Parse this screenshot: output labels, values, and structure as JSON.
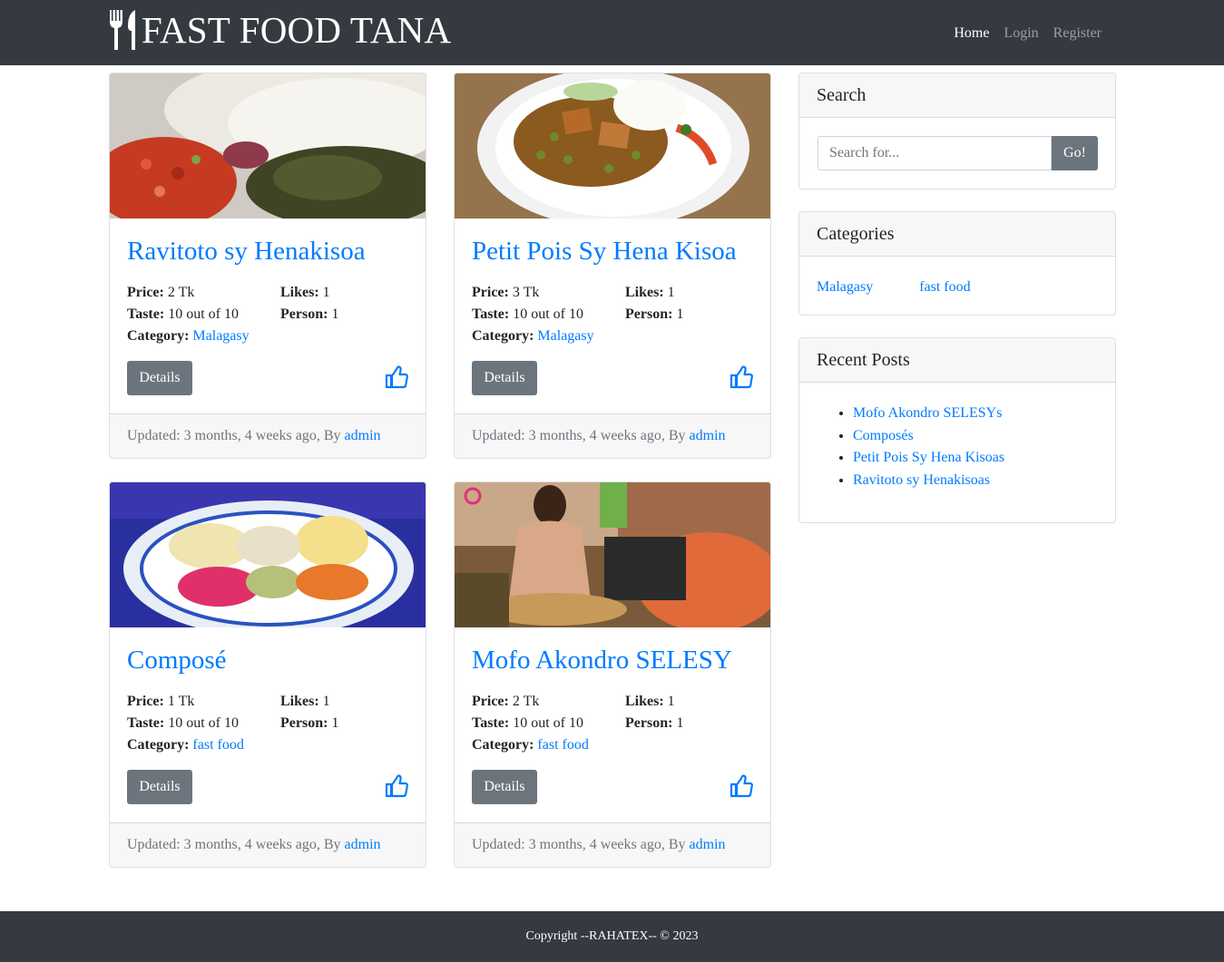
{
  "navbar": {
    "brand": "FAST FOOD TANA",
    "links": [
      {
        "label": "Home",
        "active": true
      },
      {
        "label": "Login",
        "active": false
      },
      {
        "label": "Register",
        "active": false
      }
    ]
  },
  "labels": {
    "price": "Price:",
    "taste": "Taste:",
    "category": "Category:",
    "likes": "Likes:",
    "person": "Person:",
    "details": "Details",
    "updated_prefix": "Updated: ",
    "by": ", By "
  },
  "posts": [
    {
      "title": "Ravitoto sy Henakisoa",
      "price": "2 Tk",
      "taste": "10 out of 10",
      "category": "Malagasy",
      "likes": "1",
      "person": "1",
      "updated": "3 months, 4 weeks ago",
      "author": "admin",
      "image": "rice-tomato-greens-photo"
    },
    {
      "title": "Petit Pois Sy Hena Kisoa",
      "price": "3 Tk",
      "taste": "10 out of 10",
      "category": "Malagasy",
      "likes": "1",
      "person": "1",
      "updated": "3 months, 4 weeks ago",
      "author": "admin",
      "image": "pork-peas-plate-photo"
    },
    {
      "title": "Composé",
      "price": "1 Tk",
      "taste": "10 out of 10",
      "category": "fast food",
      "likes": "1",
      "person": "1",
      "updated": "3 months, 4 weeks ago",
      "author": "admin",
      "image": "mixed-salad-bowl-photo"
    },
    {
      "title": "Mofo Akondro SELESY",
      "price": "2 Tk",
      "taste": "10 out of 10",
      "category": "fast food",
      "likes": "1",
      "person": "1",
      "updated": "3 months, 4 weeks ago",
      "author": "admin",
      "image": "street-vendor-frying-photo"
    }
  ],
  "sidebar": {
    "search": {
      "title": "Search",
      "placeholder": "Search for...",
      "button": "Go!"
    },
    "categories": {
      "title": "Categories",
      "items": [
        "Malagasy",
        "fast food"
      ]
    },
    "recent": {
      "title": "Recent Posts",
      "items": [
        "Mofo Akondro SELESYs",
        "Composés",
        "Petit Pois Sy Hena Kisoas",
        "Ravitoto sy Henakisoas"
      ]
    }
  },
  "footer": {
    "text": "Copyright --RAHATEX-- © 2023"
  },
  "colors": {
    "navbar": "#343a40",
    "link": "#007bff",
    "button": "#6c757d",
    "card_footer": "#f7f7f7"
  }
}
